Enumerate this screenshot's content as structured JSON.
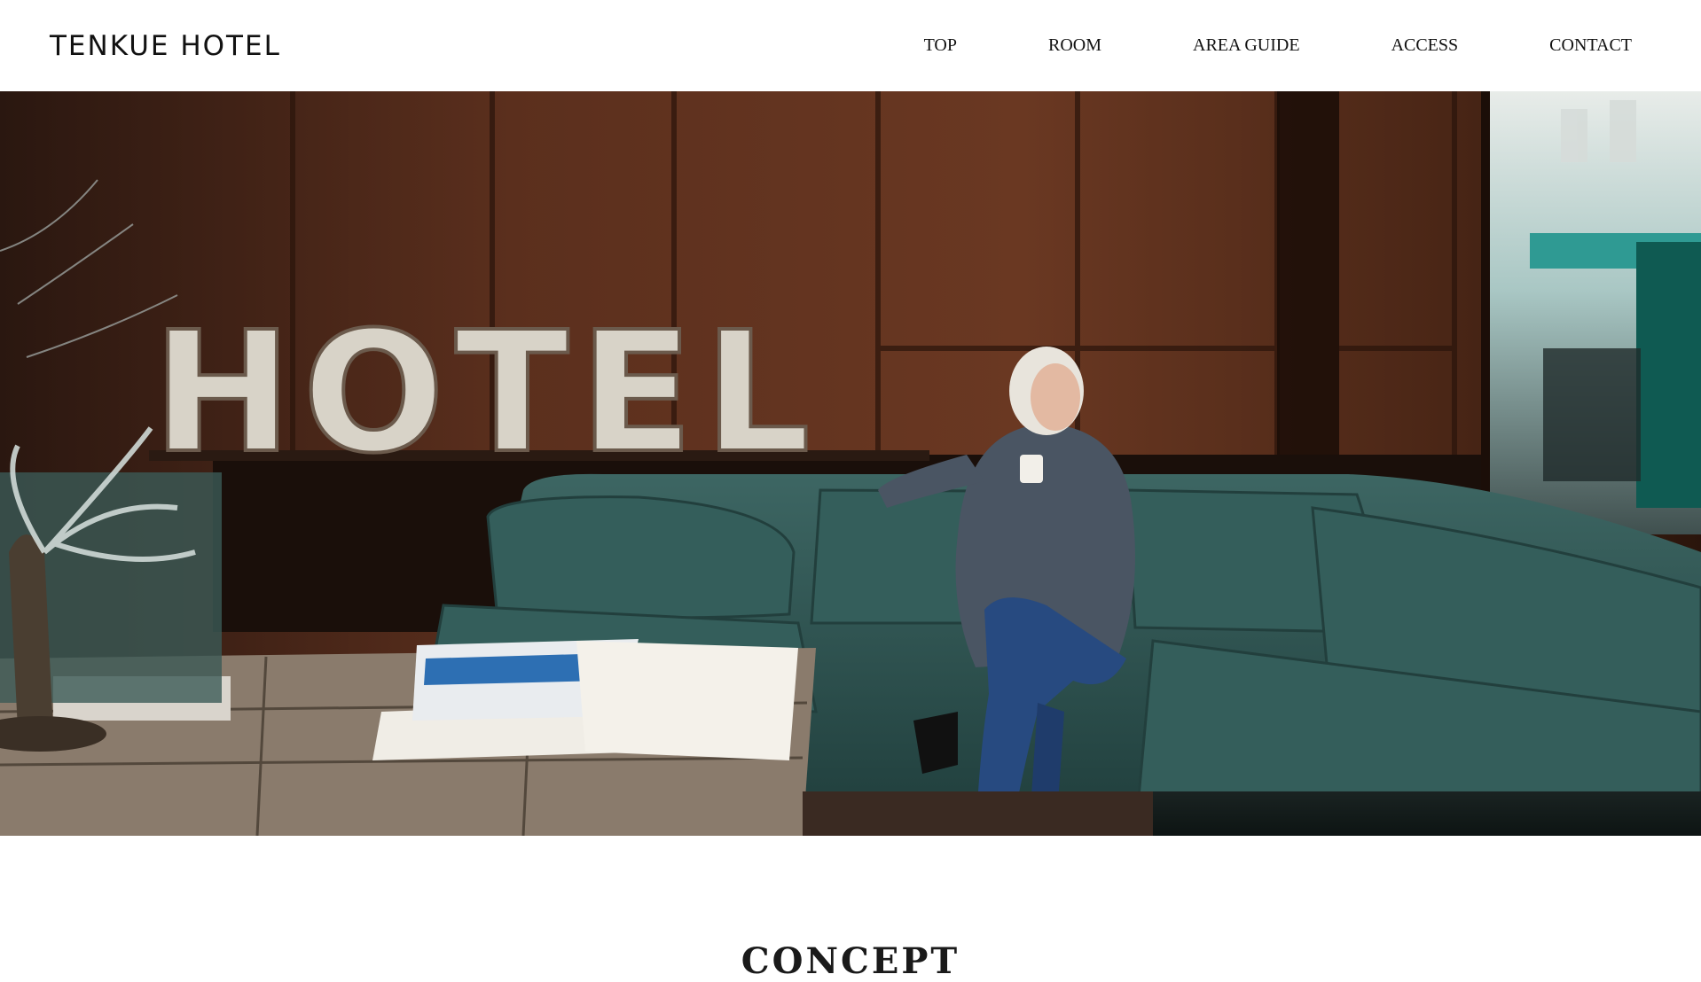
{
  "header": {
    "logo": "TENKUE HOTEL",
    "nav": [
      {
        "label": "TOP"
      },
      {
        "label": "ROOM"
      },
      {
        "label": "AREA GUIDE"
      },
      {
        "label": "ACCESS"
      },
      {
        "label": "CONTACT"
      }
    ]
  },
  "hero": {
    "sign_text": "HOTEL"
  },
  "section": {
    "title": "CONCEPT"
  },
  "colors": {
    "wood": "#5a2e1c",
    "sofa": "#2f5653",
    "text": "#111111"
  }
}
